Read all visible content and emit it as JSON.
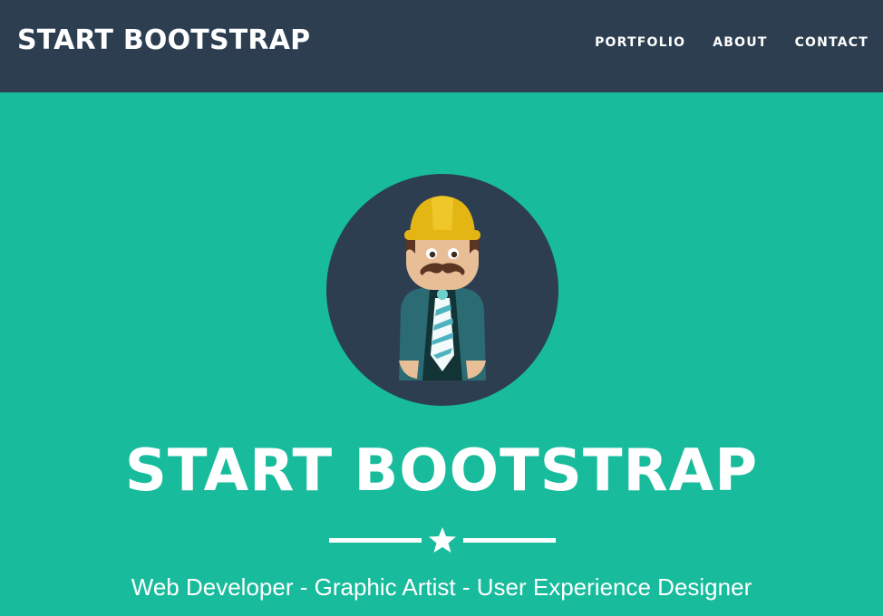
{
  "navbar": {
    "brand": "START BOOTSTRAP",
    "links": [
      "PORTFOLIO",
      "ABOUT",
      "CONTACT"
    ]
  },
  "hero": {
    "title": "START BOOTSTRAP",
    "subtitle": "Web Developer - Graphic Artist - User Experience Designer",
    "avatar_icon": "construction-worker-avatar-icon",
    "divider_icon": "star-icon"
  },
  "colors": {
    "navbar_bg": "#2c3e50",
    "hero_bg": "#18bc9c",
    "text": "#ffffff"
  }
}
